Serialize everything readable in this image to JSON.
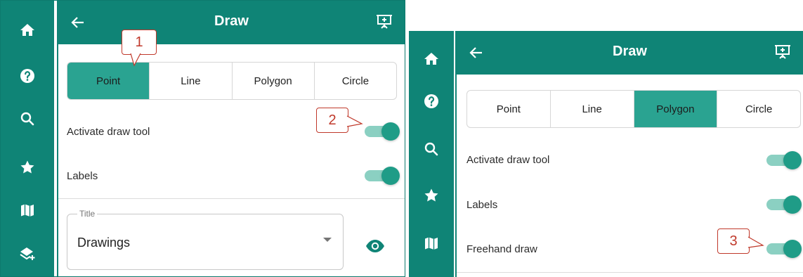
{
  "panels": [
    {
      "header": {
        "title": "Draw"
      },
      "rail": [
        "home-icon",
        "help-icon",
        "search-icon",
        "star-icon",
        "map-icon",
        "layers-add-icon"
      ],
      "tabs": [
        {
          "label": "Point",
          "active": true
        },
        {
          "label": "Line",
          "active": false
        },
        {
          "label": "Polygon",
          "active": false
        },
        {
          "label": "Circle",
          "active": false
        }
      ],
      "toggles": [
        {
          "label": "Activate draw tool",
          "on": true
        },
        {
          "label": "Labels",
          "on": true
        }
      ],
      "title_field": {
        "legend": "Title",
        "value": "Drawings"
      }
    },
    {
      "header": {
        "title": "Draw"
      },
      "rail": [
        "home-icon",
        "help-icon",
        "search-icon",
        "star-icon",
        "map-icon"
      ],
      "tabs": [
        {
          "label": "Point",
          "active": false
        },
        {
          "label": "Line",
          "active": false
        },
        {
          "label": "Polygon",
          "active": true
        },
        {
          "label": "Circle",
          "active": false
        }
      ],
      "toggles": [
        {
          "label": "Activate draw tool",
          "on": true
        },
        {
          "label": "Labels",
          "on": true
        },
        {
          "label": "Freehand draw",
          "on": true
        }
      ]
    }
  ],
  "callouts": [
    "1",
    "2",
    "3"
  ],
  "colors": {
    "teal": "#0f8476",
    "active_tab": "#2aa391",
    "toggle_knob": "#1f9c87",
    "toggle_track": "#8bd0c2",
    "callout": "#c0392b"
  }
}
